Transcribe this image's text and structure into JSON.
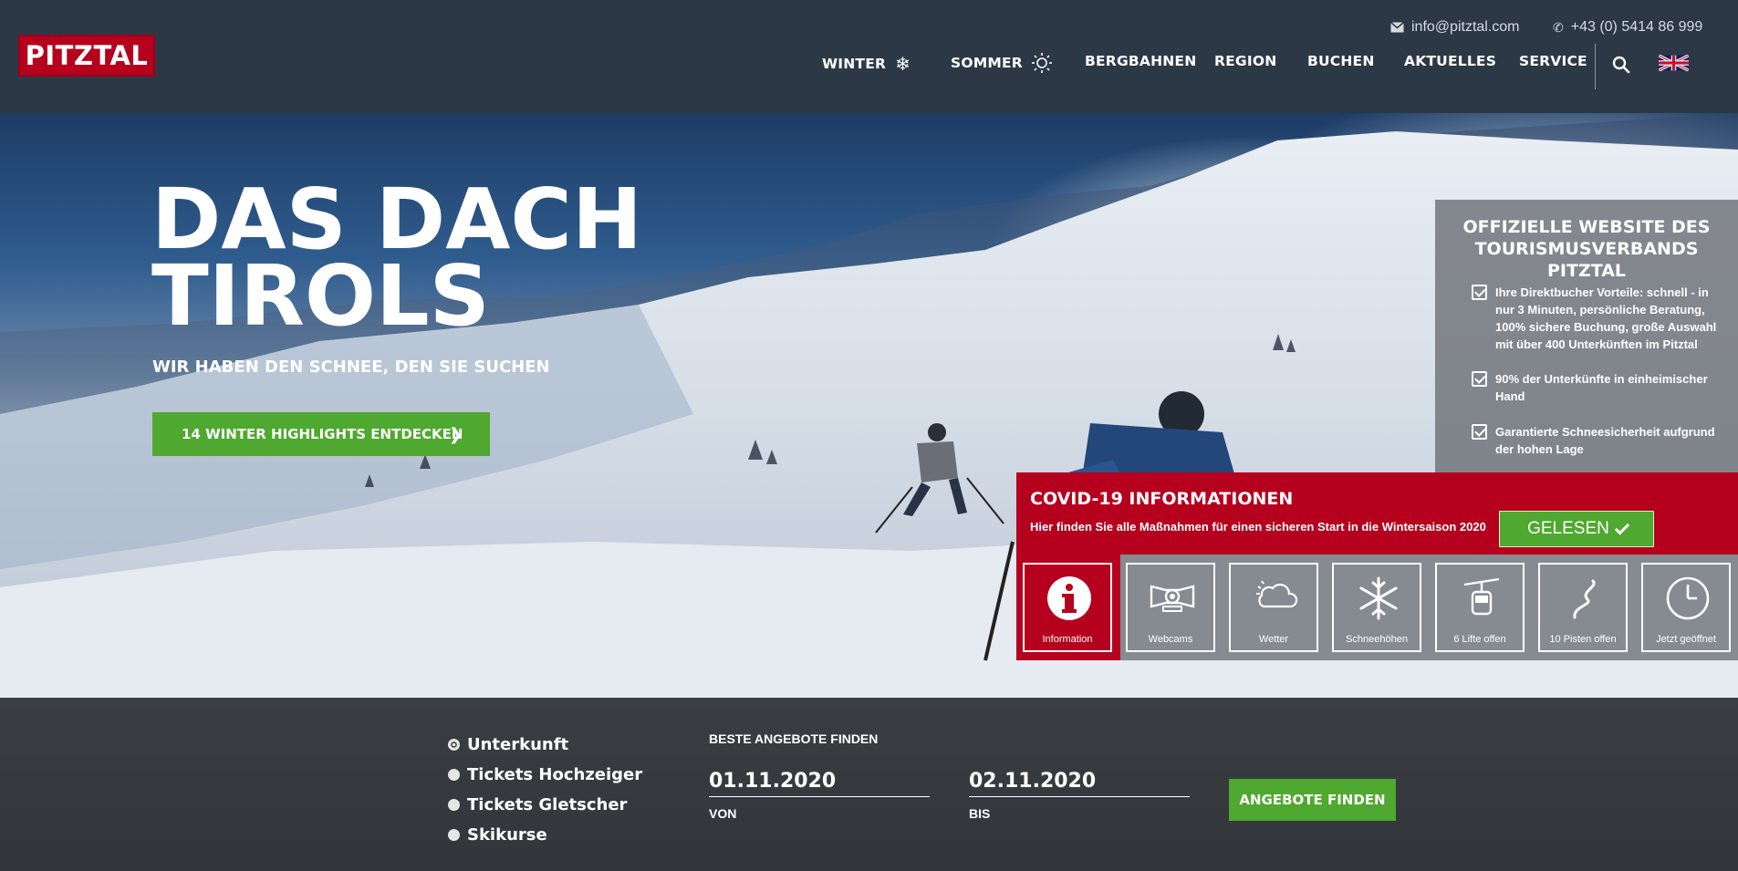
{
  "header": {
    "logo": "PITZTAL",
    "email": "info@pitztal.com",
    "phone": "+43 (0) 5414 86 999",
    "nav": [
      "WINTER",
      "SOMMER",
      "BERGBAHNEN",
      "REGION",
      "BUCHEN",
      "AKTUELLES",
      "SERVICE"
    ],
    "icons": [
      "search-icon",
      "uk-flag-icon"
    ]
  },
  "hero": {
    "title_line1": "DAS DACH",
    "title_line2": "TIROLS",
    "subtitle": "WIR HABEN DEN SCHNEE, DEN SIE SUCHEN",
    "cta": "14 WINTER HIGHLIGHTS ENTDECKEN"
  },
  "official": {
    "title": "OFFIZIELLE WEBSITE DES TOURISMUSVERBANDS PITZTAL",
    "items": [
      "Ihre Direktbucher Vorteile:  schnell - in nur 3 Minuten, persönliche Beratung, 100% sichere Buchung, große Auswahl  mit über 400 Unterkünften im Pitztal",
      "90% der Unterkünfte in einheimischer Hand",
      "Garantierte Schneesicherheit aufgrund der hohen Lage"
    ]
  },
  "covid": {
    "title": "COVID-19 INFORMATIONEN",
    "text": "Hier finden Sie alle Maßnahmen für einen sicheren Start in die Wintersaison 2020",
    "button": "GELESEN"
  },
  "tiles": [
    "Information",
    "Webcams",
    "Wetter",
    "Schneehöhen",
    "6 Lifte offen",
    "10 Pisten offen",
    "Jetzt geöffnet"
  ],
  "booking": {
    "options": [
      "Unterkunft",
      "Tickets Hochzeiger",
      "Tickets Gletscher",
      "Skikurse"
    ],
    "selected": "Unterkunft",
    "heading": "BESTE ANGEBOTE FINDEN",
    "from_value": "01.11.2020",
    "from_label": "VON",
    "to_value": "02.11.2020",
    "to_label": "BIS",
    "button": "ANGEBOTE FINDEN"
  },
  "colors": {
    "brand_red": "#b5001e",
    "green": "#4fa82f",
    "header_bg": "#2d3847"
  }
}
